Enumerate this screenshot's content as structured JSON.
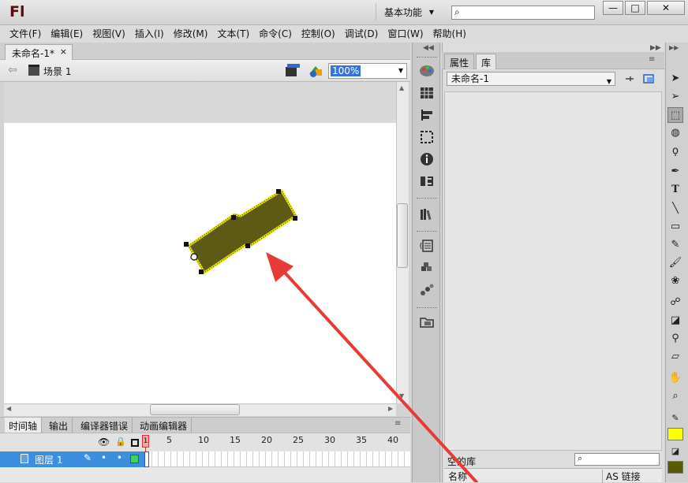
{
  "app": {
    "logo": "Fl"
  },
  "titlebar": {
    "workspace": "基本功能",
    "search_placeholder": "",
    "minimize": "—",
    "maximize": "□",
    "close": "✕"
  },
  "menu": [
    "文件(F)",
    "编辑(E)",
    "视图(V)",
    "插入(I)",
    "修改(M)",
    "文本(T)",
    "命令(C)",
    "控制(O)",
    "调试(D)",
    "窗口(W)",
    "帮助(H)"
  ],
  "document": {
    "tab_title": "未命名-1*",
    "tab_close": "×",
    "scene": "场景 1",
    "zoom": "100%"
  },
  "timeline": {
    "tabs": [
      "时间轴",
      "输出",
      "编译器错误",
      "动画编辑器"
    ],
    "frame_numbers": [
      "1",
      "5",
      "10",
      "15",
      "20",
      "25",
      "30",
      "35",
      "40"
    ],
    "current_frame": "1",
    "layer": {
      "name": "图层 1",
      "dot1": "•",
      "dot2": "•"
    }
  },
  "library": {
    "tabs": [
      "属性",
      "库"
    ],
    "document_select": "未命名-1",
    "footer_label": "空的库",
    "columns": [
      "名称",
      "AS 链接"
    ]
  },
  "tools": [
    "selection-tool",
    "subselection-tool",
    "free-transform-tool",
    "3d-rotation-tool",
    "lasso-tool",
    "pen-tool",
    "text-tool",
    "line-tool",
    "rectangle-tool",
    "pencil-tool",
    "brush-tool",
    "deco-tool",
    "bone-tool",
    "paint-bucket-tool",
    "eyedropper-tool",
    "eraser-tool",
    "hand-tool",
    "zoom-tool"
  ],
  "colors": {
    "stroke": "#ffff00",
    "fill": "#5a5a00",
    "shape_fill": "#5c5a14",
    "shape_stroke": "#e8e800",
    "annotation_arrow": "#e83a36",
    "selection_blue": "#3d8ede"
  }
}
